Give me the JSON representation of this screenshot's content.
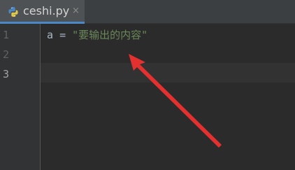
{
  "tab": {
    "filename": "ceshi.py",
    "close_symbol": "×",
    "icon": "python-file-icon",
    "accent_color": "#4a88c7"
  },
  "gutter": {
    "line_numbers": [
      "1",
      "2",
      "3"
    ],
    "active_line": "3"
  },
  "editor": {
    "lines": [
      {
        "variable": "a",
        "operator": "=",
        "string": "\"要输出的内容\""
      },
      {},
      {}
    ]
  },
  "colors": {
    "background": "#2b2b2b",
    "string": "#6a8759",
    "identifier": "#a9b7c6",
    "arrow": "#e53030"
  },
  "annotation": {
    "type": "arrow",
    "icon": "red-arrow-icon"
  }
}
